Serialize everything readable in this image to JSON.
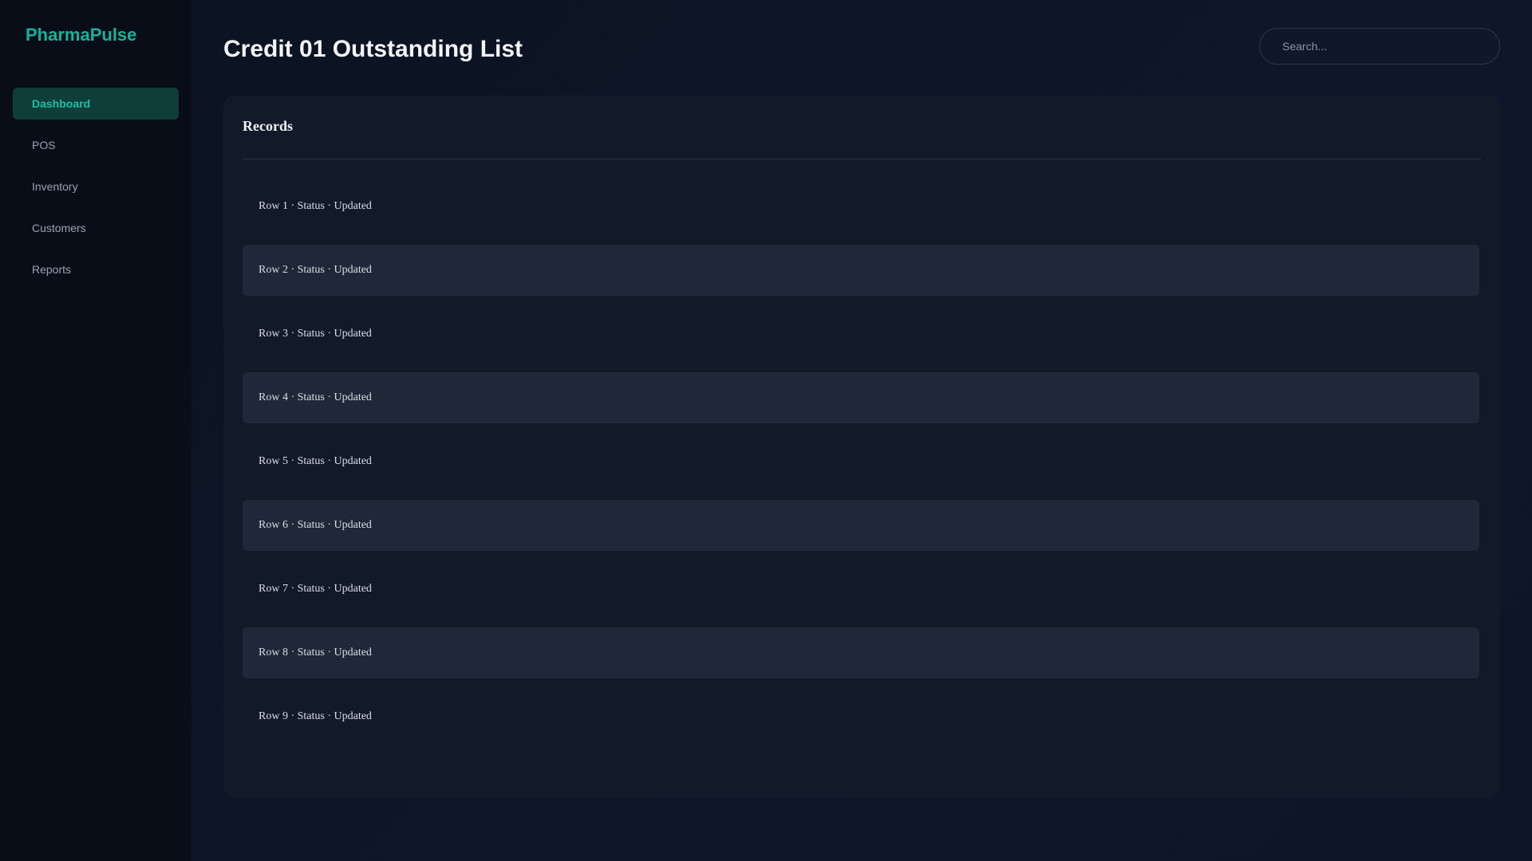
{
  "brand": {
    "name": "PharmaPulse"
  },
  "sidebar": {
    "items": [
      {
        "label": "Dashboard",
        "active": true
      },
      {
        "label": "POS",
        "active": false
      },
      {
        "label": "Inventory",
        "active": false
      },
      {
        "label": "Customers",
        "active": false
      },
      {
        "label": "Reports",
        "active": false
      }
    ]
  },
  "header": {
    "title": "Credit 01 Outstanding List",
    "search_placeholder": "Search..."
  },
  "card": {
    "title": "Records",
    "rows": [
      "Row 1 · Status · Updated",
      "Row 2 · Status · Updated",
      "Row 3 · Status · Updated",
      "Row 4 · Status · Updated",
      "Row 5 · Status · Updated",
      "Row 6 · Status · Updated",
      "Row 7 · Status · Updated",
      "Row 8 · Status · Updated",
      "Row 9 · Status · Updated"
    ]
  },
  "colors": {
    "accent": "#16b39a",
    "active_nav_bg": "#0f3d3a",
    "sidebar_bg": "#080d17",
    "card_bg": "#121a2a",
    "alt_row_bg": "#1f2838"
  }
}
